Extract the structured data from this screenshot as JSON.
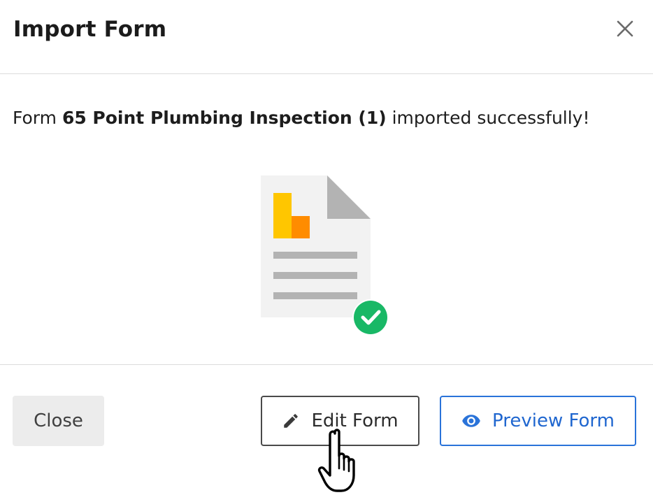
{
  "dialog": {
    "title": "Import Form",
    "close_icon": "close-x-icon"
  },
  "message": {
    "prefix": "Form",
    "form_name": "65 Point Plumbing Inspection (1)",
    "suffix": "imported successfully!"
  },
  "illustration": {
    "icon": "document-chart-success-icon",
    "colors": {
      "page": "#f2f2f2",
      "fold": "#b3b3b3",
      "bar_yellow": "#ffc600",
      "bar_orange": "#ff8c00",
      "lines": "#b3b3b3",
      "check_circle": "#19b866"
    }
  },
  "footer": {
    "close_label": "Close",
    "edit_label": "Edit Form",
    "edit_icon": "pencil-icon",
    "preview_label": "Preview Form",
    "preview_icon": "eye-icon"
  },
  "colors": {
    "primary": "#2a73d9",
    "divider": "#dcdcdc",
    "secondary_button_bg": "#ececec"
  },
  "cursor": "hand-pointer-icon"
}
